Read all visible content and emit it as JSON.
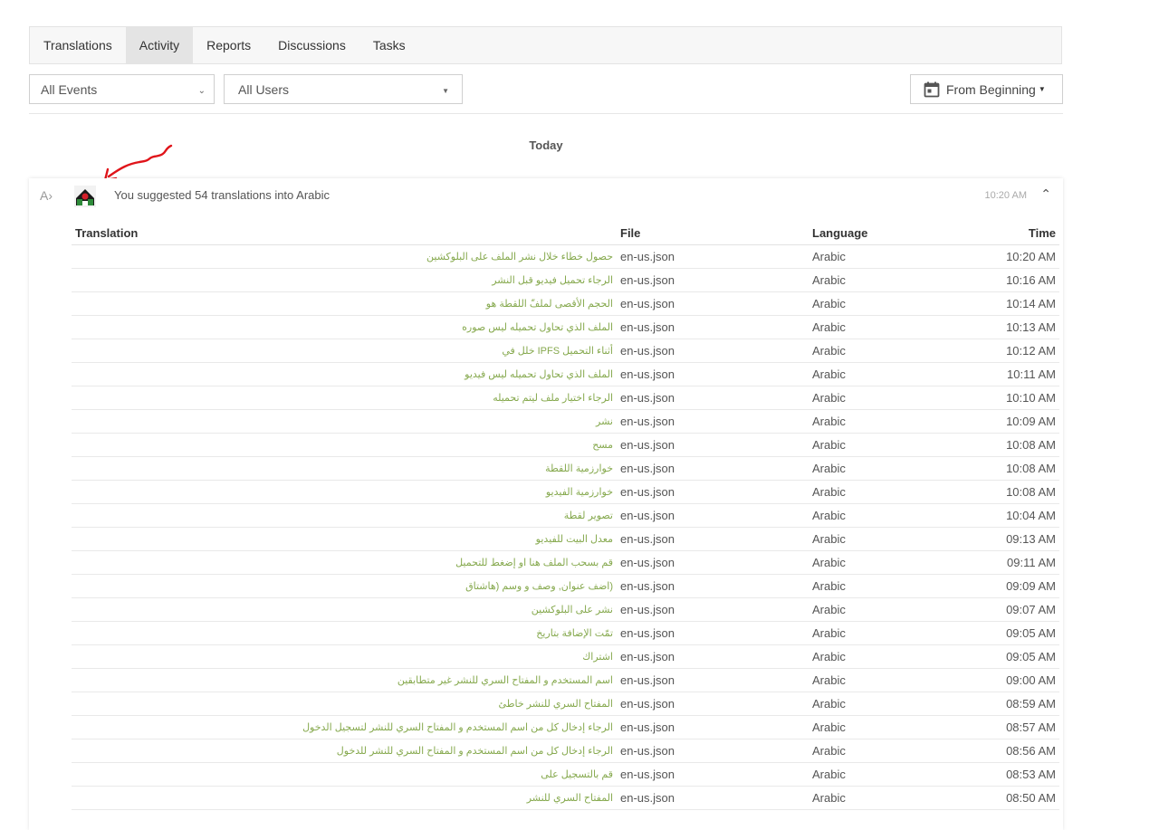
{
  "tabs": [
    {
      "label": "Translations"
    },
    {
      "label": "Activity",
      "active": true
    },
    {
      "label": "Reports"
    },
    {
      "label": "Discussions"
    },
    {
      "label": "Tasks"
    }
  ],
  "filters": {
    "events": "All Events",
    "users": "All Users",
    "date_range": "From Beginning"
  },
  "day_label": "Today",
  "activity": {
    "summary": "You suggested 54 translations into Arabic",
    "time": "10:20 AM",
    "columns": {
      "translation": "Translation",
      "file": "File",
      "language": "Language",
      "time": "Time"
    },
    "rows": [
      {
        "translation": "حصول خطاء خلال نشر الملف على البلوكشين",
        "file": "en-us.json",
        "language": "Arabic",
        "time": "10:20 AM"
      },
      {
        "translation": "الرجاء تحميل فيديو قبل النشر",
        "file": "en-us.json",
        "language": "Arabic",
        "time": "10:16 AM"
      },
      {
        "translation": "الحجم الأقصى لملفّ اللقطة هو",
        "file": "en-us.json",
        "language": "Arabic",
        "time": "10:14 AM"
      },
      {
        "translation": "الملف الذي تحاول تحميله ليس صوره",
        "file": "en-us.json",
        "language": "Arabic",
        "time": "10:13 AM"
      },
      {
        "translation": "أثناء التحميل IPFS خلل في",
        "file": "en-us.json",
        "language": "Arabic",
        "time": "10:12 AM"
      },
      {
        "translation": "الملف الذي تحاول تحميله ليس فيديو",
        "file": "en-us.json",
        "language": "Arabic",
        "time": "10:11 AM"
      },
      {
        "translation": "الرجاء اختيار ملف ليتم تحميله",
        "file": "en-us.json",
        "language": "Arabic",
        "time": "10:10 AM"
      },
      {
        "translation": "نشر",
        "file": "en-us.json",
        "language": "Arabic",
        "time": "10:09 AM"
      },
      {
        "translation": "مسح",
        "file": "en-us.json",
        "language": "Arabic",
        "time": "10:08 AM"
      },
      {
        "translation": "خوارزمية اللقطة",
        "file": "en-us.json",
        "language": "Arabic",
        "time": "10:08 AM"
      },
      {
        "translation": "خوارزمية الفيديو",
        "file": "en-us.json",
        "language": "Arabic",
        "time": "10:08 AM"
      },
      {
        "translation": "تصوير لقطة",
        "file": "en-us.json",
        "language": "Arabic",
        "time": "10:04 AM"
      },
      {
        "translation": "معدل البيت للفيديو",
        "file": "en-us.json",
        "language": "Arabic",
        "time": "09:13 AM"
      },
      {
        "translation": "قم بسحب الملف هنا او إضغط للتحميل",
        "file": "en-us.json",
        "language": "Arabic",
        "time": "09:11 AM"
      },
      {
        "translation": "(اضف عنوان, وصف و وسم (هاشتاق",
        "file": "en-us.json",
        "language": "Arabic",
        "time": "09:09 AM"
      },
      {
        "translation": "نشر على البلوكشين",
        "file": "en-us.json",
        "language": "Arabic",
        "time": "09:07 AM"
      },
      {
        "translation": "تمّت الإضافة بتاريخ",
        "file": "en-us.json",
        "language": "Arabic",
        "time": "09:05 AM"
      },
      {
        "translation": "اشتراك",
        "file": "en-us.json",
        "language": "Arabic",
        "time": "09:05 AM"
      },
      {
        "translation": "اسم المستخدم و المفتاح السري للنشر غير متطابقين",
        "file": "en-us.json",
        "language": "Arabic",
        "time": "09:00 AM"
      },
      {
        "translation": "المفتاح السري للنشر خاطئ",
        "file": "en-us.json",
        "language": "Arabic",
        "time": "08:59 AM"
      },
      {
        "translation": "الرجاء إدخال كل من اسم المستخدم و المفتاح السري للنشر لتسجيل الدخول",
        "file": "en-us.json",
        "language": "Arabic",
        "time": "08:57 AM"
      },
      {
        "translation": "الرجاء إدخال كل من اسم المستخدم و المفتاح السري للنشر للدخول",
        "file": "en-us.json",
        "language": "Arabic",
        "time": "08:56 AM"
      },
      {
        "translation": "قم بالتسجيل على",
        "file": "en-us.json",
        "language": "Arabic",
        "time": "08:53 AM"
      },
      {
        "translation": "المفتاح السري للنشر",
        "file": "en-us.json",
        "language": "Arabic",
        "time": "08:50 AM"
      }
    ]
  },
  "colors": {
    "accent_green": "#86a94e",
    "annotation_arrow": "#e0141a"
  },
  "icons": {
    "activity_type": "translate-icon",
    "date": "calendar-icon",
    "collapse": "chevron-up-icon"
  }
}
